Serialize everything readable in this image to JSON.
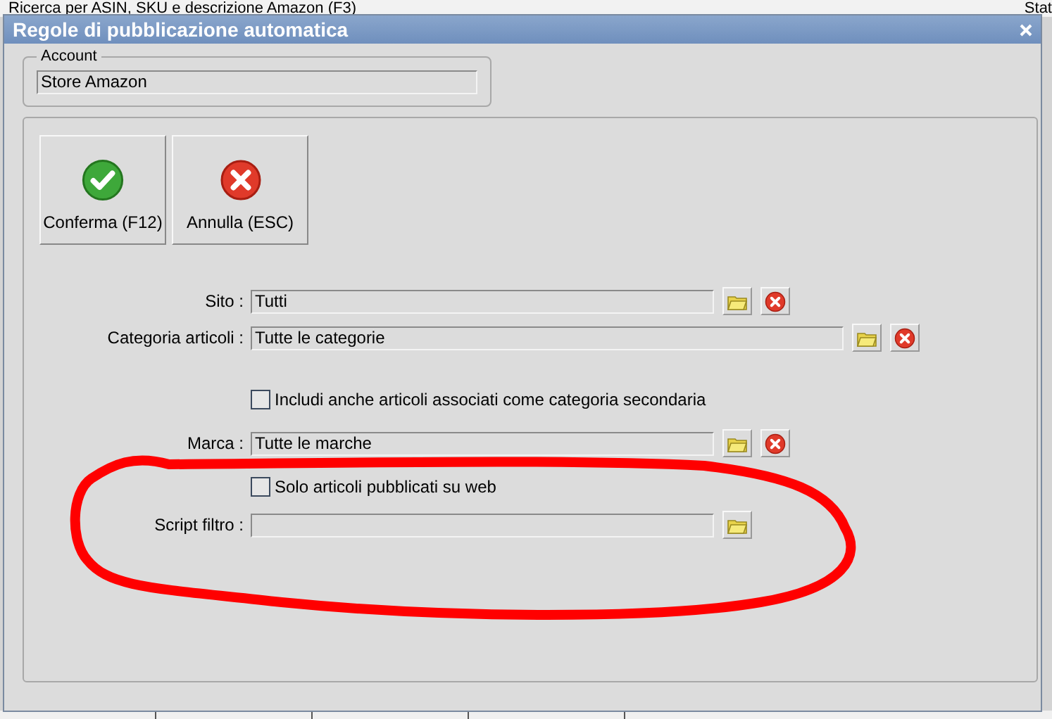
{
  "background": {
    "search_label": "Ricerca per ASIN, SKU e descrizione Amazon (F3)",
    "column_label": "Stat"
  },
  "dialog": {
    "title": "Regole di pubblicazione automatica",
    "account": {
      "legend": "Account",
      "value": "Store Amazon"
    },
    "buttons": [
      {
        "kind": "confirm",
        "label": "Conferma (F12)"
      },
      {
        "kind": "cancel",
        "label": "Annulla (ESC)"
      }
    ],
    "rows": [
      {
        "kind": "field",
        "label": "Sito :",
        "value": "Tutti",
        "browse": true,
        "clear": true
      },
      {
        "kind": "field",
        "label": "Categoria articoli :",
        "value": "Tutte le categorie",
        "browse": true,
        "clear": true
      },
      {
        "kind": "checkbox",
        "label": "Includi anche articoli associati come categoria secondaria",
        "checked": false
      },
      {
        "kind": "field",
        "label": "Marca :",
        "value": "Tutte le marche",
        "browse": true,
        "clear": true
      },
      {
        "kind": "checkbox",
        "label": "Solo articoli pubblicati su web",
        "checked": false
      },
      {
        "kind": "field",
        "label": "Script filtro :",
        "browse": true
      }
    ]
  }
}
